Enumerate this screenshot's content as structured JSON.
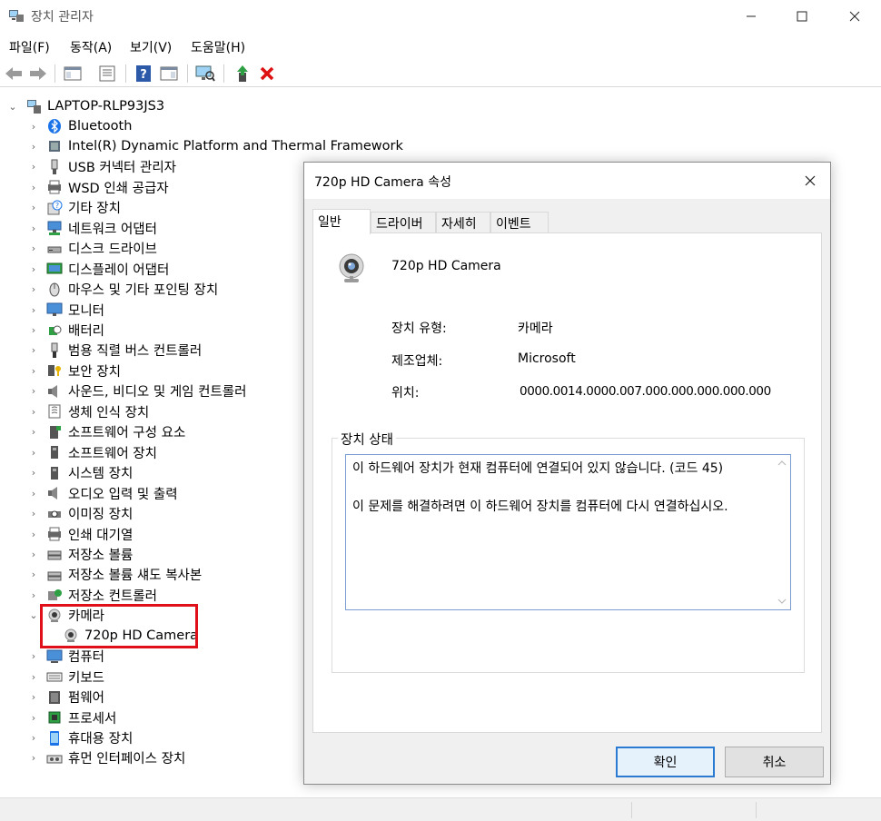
{
  "window": {
    "title": "장치 관리자"
  },
  "menu": [
    "파일(F)",
    "동작(A)",
    "보기(V)",
    "도움말(H)"
  ],
  "tree": {
    "root": "LAPTOP-RLP93JS3",
    "categories": [
      "Bluetooth",
      "Intel(R) Dynamic Platform and Thermal Framework",
      "USB 커넥터 관리자",
      "WSD 인쇄 공급자",
      "기타 장치",
      "네트워크 어댑터",
      "디스크 드라이브",
      "디스플레이 어댑터",
      "마우스 및 기타 포인팅 장치",
      "모니터",
      "배터리",
      "범용 직렬 버스 컨트롤러",
      "보안 장치",
      "사운드, 비디오 및 게임 컨트롤러",
      "생체 인식 장치",
      "소프트웨어 구성 요소",
      "소프트웨어 장치",
      "시스템 장치",
      "오디오 입력 및 출력",
      "이미징 장치",
      "인쇄 대기열",
      "저장소 볼륨",
      "저장소 볼륨 섀도 복사본",
      "저장소 컨트롤러",
      "카메라",
      "720p HD Camera",
      "컴퓨터",
      "키보드",
      "펌웨어",
      "프로세서",
      "휴대용 장치",
      "휴먼 인터페이스 장치"
    ]
  },
  "dialog": {
    "title": "720p HD Camera 속성",
    "tabs": [
      "일반",
      "드라이버",
      "자세히",
      "이벤트"
    ],
    "device_name": "720p HD Camera",
    "type_label": "장치 유형:",
    "type_value": "카메라",
    "maker_label": "제조업체:",
    "maker_value": "Microsoft",
    "location_label": "위치:",
    "location_value": "0000.0014.0000.007.000.000.000.000.000",
    "status_group": "장치 상태",
    "status_text": "이 하드웨어 장치가 현재 컴퓨터에 연결되어 있지 않습니다. (코드 45)\n\n이 문제를 해결하려면 이 하드웨어 장치를 컴퓨터에 다시 연결하십시오.",
    "ok": "확인",
    "cancel": "취소"
  }
}
